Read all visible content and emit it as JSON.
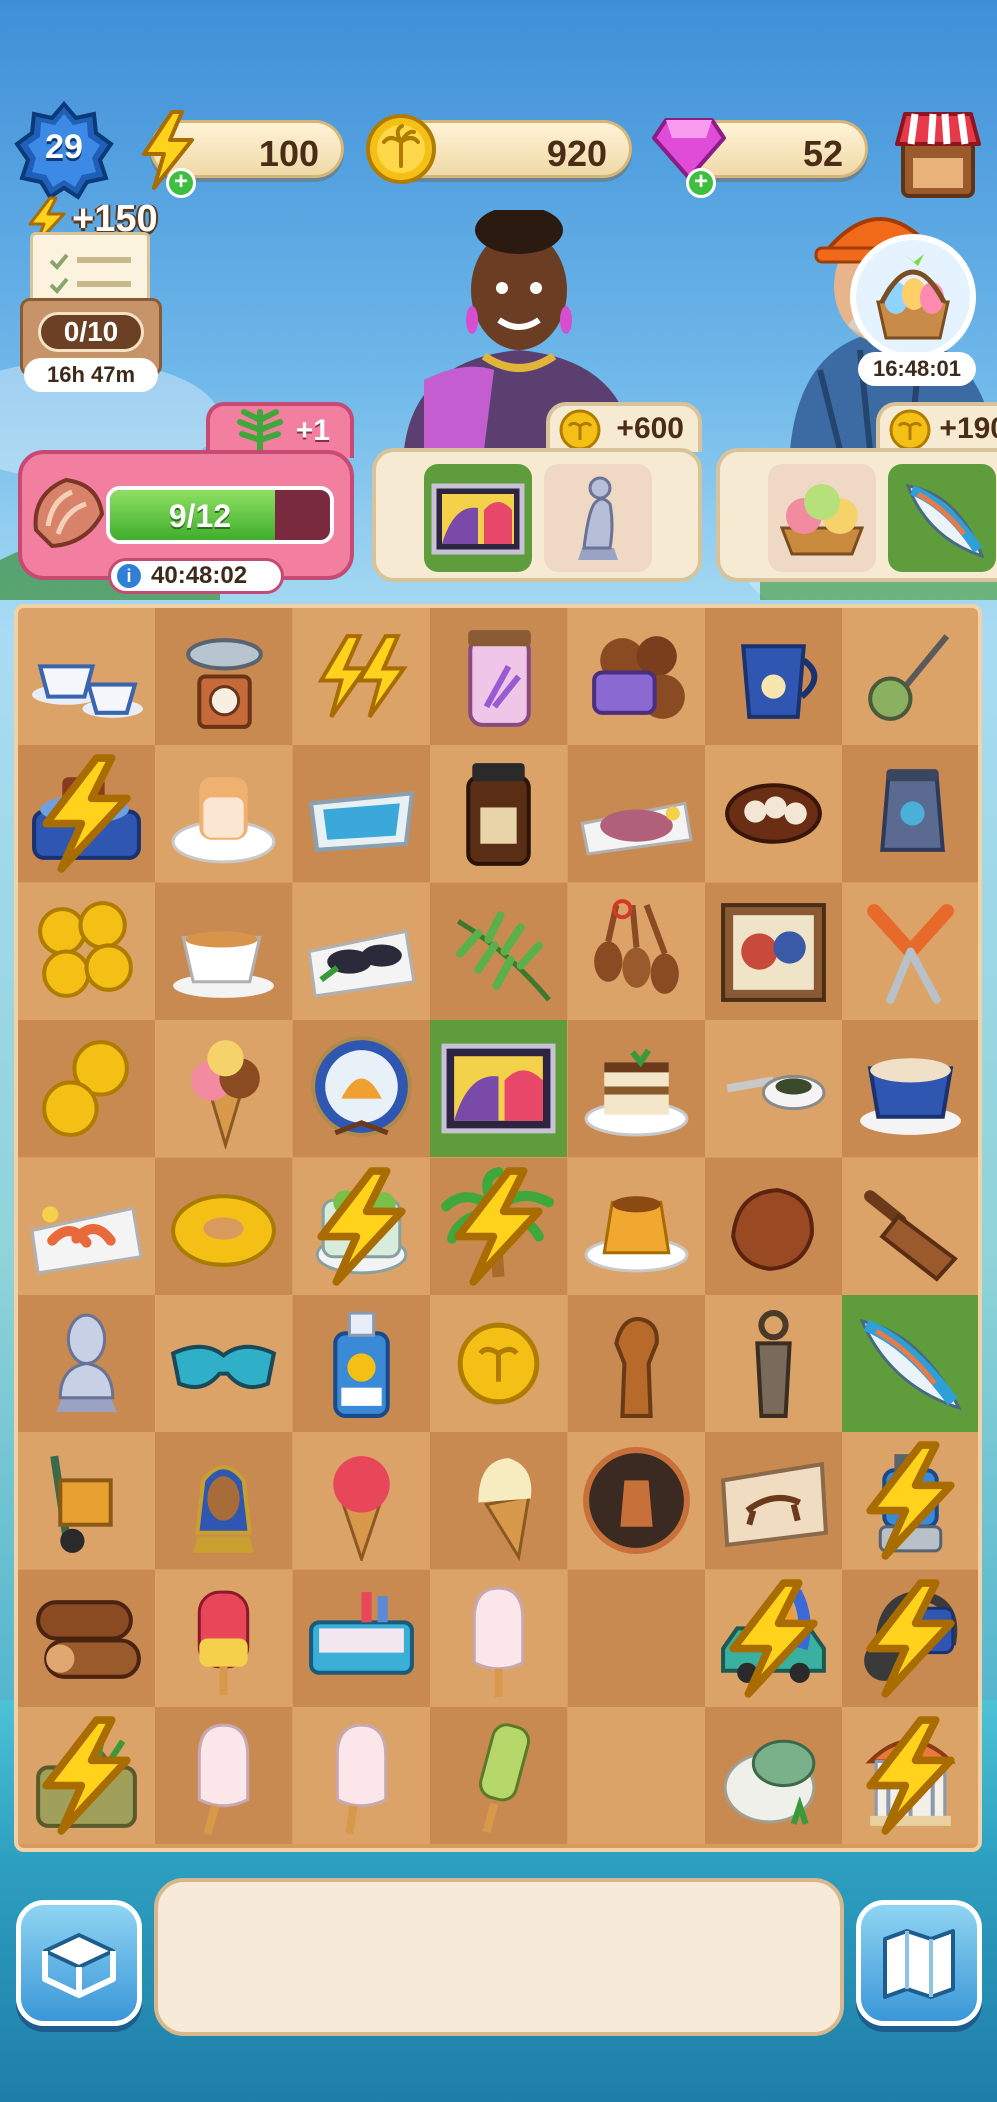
{
  "player": {
    "level": "29"
  },
  "resources": {
    "energy": "100",
    "coins": "920",
    "gems": "52"
  },
  "tasks": {
    "energy_bonus": "+150",
    "progress": "0/10",
    "timer": "16h 47m"
  },
  "event": {
    "reward_label": "+1",
    "progress_text": "9/12",
    "progress_fraction": 0.75,
    "timer": "40:48:02"
  },
  "orders": [
    {
      "character": "woman-with-earrings",
      "reward": "+600",
      "items": [
        "abstract-painting",
        "silver-statue"
      ],
      "fulfilled": [
        true,
        false
      ]
    },
    {
      "character": "construction-worker",
      "reward": "+190",
      "items": [
        "ice-cream-scoops",
        "surfboard"
      ],
      "fulfilled": [
        false,
        true
      ],
      "timer": "16:48:01"
    }
  ],
  "board": {
    "rows": [
      [
        "teacups",
        "kitchen-scale",
        "energy-bolts",
        "lavender-jar",
        "soap-beans",
        "cream-jug",
        "tea-strainer"
      ],
      [
        "pottery-wheel",
        "pudding-plate",
        "pool-tile",
        "brown-jar",
        "fish-plate",
        "cocoa-pods",
        "vase"
      ],
      [
        "coin-stack-large",
        "tea-cup",
        "mussel-plate",
        "fern-branch",
        "wooden-spoons",
        "framed-painting",
        "garden-shears"
      ],
      [
        "coin-pair",
        "ice-cream-cone",
        "decor-plate",
        "abstract-painting",
        "tiramisu",
        "spoon-snack",
        "cappuccino"
      ],
      [
        "shrimp-plate",
        "swim-ring",
        "succulent-jar",
        "palm-tree",
        "flan",
        "clay-lump",
        "wooden-scoop"
      ],
      [
        "bust-statue",
        "sunglasses",
        "sunscreen",
        "single-coin",
        "wooden-figurine",
        "ancient-idol",
        "surfboard"
      ],
      [
        "hand-truck",
        "pharaoh-bust",
        "strawberry-cone",
        "vanilla-cone",
        "greek-plate",
        "cave-drawing",
        "blender"
      ],
      [
        "logs",
        "popsicle-red",
        "ice-cream-cart",
        "popsicle-white",
        "",
        "surf-car",
        "headphones"
      ],
      [
        "garden-bag",
        "popsicle-white-2",
        "popsicle-white-3",
        "popsicle-green",
        "",
        "turtle-egg",
        "gazebo"
      ]
    ]
  },
  "colors": {
    "accent_pink": "#f27fa0",
    "progress_green": "#3fae2c",
    "board_tile": "#d99a5e",
    "done_tile": "#5e9c3c"
  }
}
